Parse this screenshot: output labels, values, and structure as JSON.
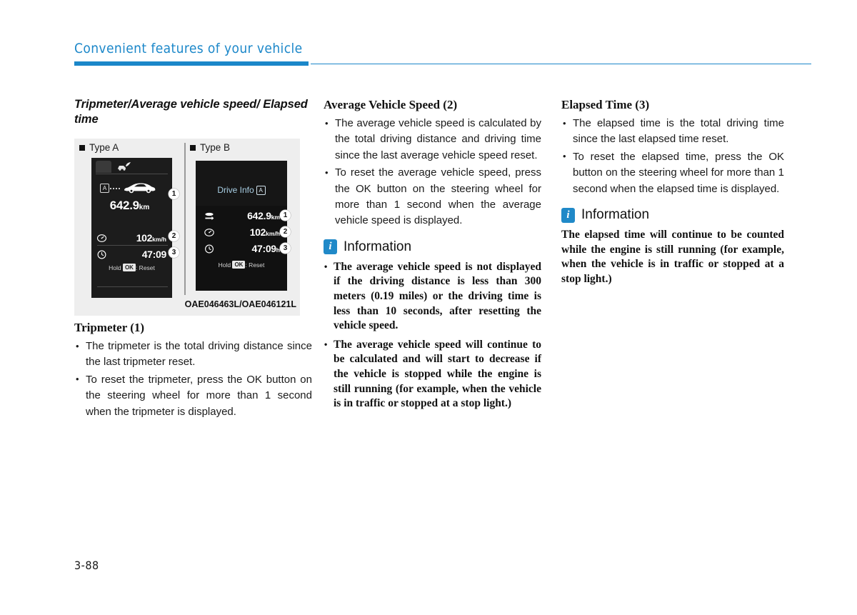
{
  "header": {
    "title": "Convenient features of your vehicle",
    "accent_color": "#1b87c9"
  },
  "page_number": "3-88",
  "left_column": {
    "section_title": "Tripmeter/Average vehicle speed/ Elapsed time",
    "figure": {
      "type_a_label": "Type A",
      "type_b_label": "Type B",
      "image_code": "OAE046463L/OAE046121L",
      "type_a": {
        "badge_letter": "A",
        "distance_value": "642.9",
        "distance_unit": "km",
        "speed_value": "102",
        "speed_unit": "km/h",
        "time_value": "47:09",
        "hold_prefix": "Hold",
        "hold_key": "OK",
        "hold_suffix": ": Reset",
        "callouts": [
          "1",
          "2",
          "3"
        ]
      },
      "type_b": {
        "title": "Drive Info",
        "badge_letter": "A",
        "distance_value": "642.9",
        "distance_unit": "km",
        "speed_value": "102",
        "speed_unit": "km/h",
        "time_value": "47:09",
        "time_unit": "h",
        "hold_prefix": "Hold",
        "hold_key": "OK",
        "hold_suffix": ": Reset",
        "callouts": [
          "1",
          "2",
          "3"
        ]
      }
    },
    "sub_title": "Tripmeter (1)",
    "bullets": [
      "The tripmeter is the total driving distance since the last tripmeter reset.",
      "To reset the tripmeter, press the OK button on the steering wheel for more than 1 second when the tripmeter is displayed."
    ]
  },
  "middle_column": {
    "sub_title": "Average Vehicle Speed (2)",
    "bullets": [
      "The average vehicle speed is calculated by the total driving distance and driving time since the last average vehicle speed reset.",
      "To reset the average vehicle speed, press the OK button on the steering wheel for more than 1 second when the average vehicle speed is displayed."
    ],
    "information": {
      "icon_letter": "i",
      "title": "Information",
      "bullets": [
        "The average vehicle speed is not displayed if the driving distance is less than 300 meters (0.19 miles) or the driving time is less than 10 seconds, after resetting the vehicle speed.",
        "The average vehicle speed will continue to be calculated and will start to decrease if the vehicle is stopped while the engine is still running (for example, when the vehicle is in traffic or stopped at a stop light.)"
      ]
    }
  },
  "right_column": {
    "sub_title": "Elapsed Time (3)",
    "bullets": [
      "The elapsed time is the total driving time since the last elapsed time reset.",
      "To reset the elapsed time, press the OK button on the steering wheel for more than 1 second when the elapsed time is displayed."
    ],
    "information": {
      "icon_letter": "i",
      "title": "Information",
      "body": "The elapsed time will continue to be counted while the engine is still running (for example, when the vehicle is in traffic or stopped at a stop light.)"
    }
  }
}
